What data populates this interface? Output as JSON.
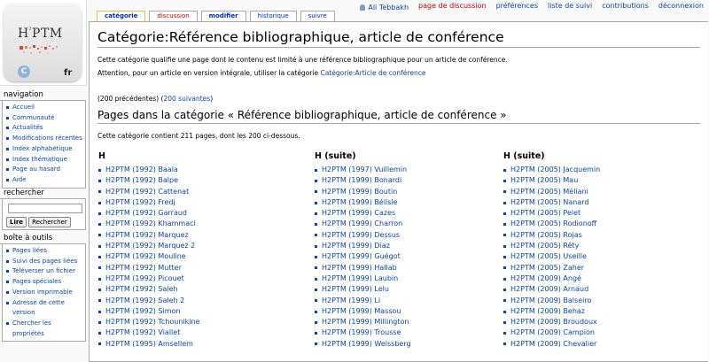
{
  "personal_tools": {
    "user": "Ali Tebbakh",
    "talk": "page de discussion",
    "preferences": "préférences",
    "watchlist": "liste de suivi",
    "contributions": "contributions",
    "logout": "déconnexion"
  },
  "logo": {
    "text": "H",
    "text_sup": "²",
    "text_rest": "PTM",
    "globe": "C",
    "lang": "fr"
  },
  "tabs": {
    "category": "catégorie",
    "discussion": "discussion",
    "edit": "modifier",
    "history": "historique",
    "watch": "suivre"
  },
  "navigation": {
    "title": "navigation",
    "items": [
      "Accueil",
      "Communauté",
      "Actualités",
      "Modifications récentes",
      "Index alphabétique",
      "Index thématique",
      "Page au hasard",
      "Aide"
    ]
  },
  "search": {
    "title": "rechercher",
    "go": "Lire",
    "search": "Rechercher"
  },
  "toolbox": {
    "title": "boîte à outils",
    "items": [
      "Pages liées",
      "Suivi des pages liées",
      "Téléverser un fichier",
      "Pages spéciales",
      "Version imprimable",
      "Adresse de cette version",
      "Chercher les propriétés"
    ]
  },
  "page": {
    "title": "Catégorie:Référence bibliographique, article de conférence",
    "intro": "Cette catégorie qualifie une page dont le contenu est limité à une référence bibliographique pour un article de conférence.",
    "attention_prefix": "Attention, pour un article en version intégrale, utiliser la catégorie ",
    "attention_link": "Catégorie:Article de conférence",
    "prev": "(200 précédentes) (",
    "next": "200 suivantes",
    "next_close": ")",
    "pages_heading": "Pages dans la catégorie « Référence bibliographique, article de conférence »",
    "count": "Cette catégorie contient 211 pages, dont les 200 ci-dessous."
  },
  "columns": [
    {
      "heading": "H",
      "items": [
        "H2PTM (1992) Baala",
        "H2PTM (1992) Balpe",
        "H2PTM (1992) Cattenat",
        "H2PTM (1992) Fredj",
        "H2PTM (1992) Garraud",
        "H2PTM (1992) Khammaci",
        "H2PTM (1992) Marquez",
        "H2PTM (1992) Marquez 2",
        "H2PTM (1992) Mouline",
        "H2PTM (1992) Mutter",
        "H2PTM (1992) Picouet",
        "H2PTM (1992) Saleh",
        "H2PTM (1992) Saleh 2",
        "H2PTM (1992) Simon",
        "H2PTM (1992) Tchounikine",
        "H2PTM (1992) Viallet",
        "H2PTM (1995) Amsellem"
      ]
    },
    {
      "heading": "H (suite)",
      "items": [
        "H2PTM (1997) Vuillemin",
        "H2PTM (1999) Bonardi",
        "H2PTM (1999) Boutin",
        "H2PTM (1999) Bélisle",
        "H2PTM (1999) Cazes",
        "H2PTM (1999) Charron",
        "H2PTM (1999) Dessus",
        "H2PTM (1999) Diaz",
        "H2PTM (1999) Guégot",
        "H2PTM (1999) Hallab",
        "H2PTM (1999) Laubin",
        "H2PTM (1999) Lelu",
        "H2PTM (1999) Li",
        "H2PTM (1999) Massou",
        "H2PTM (1999) Millington",
        "H2PTM (1999) Trousse",
        "H2PTM (1999) Weissberg"
      ]
    },
    {
      "heading": "H (suite)",
      "items": [
        "H2PTM (2005) Jacquemin",
        "H2PTM (2005) Mau",
        "H2PTM (2005) Méliani",
        "H2PTM (2005) Nanard",
        "H2PTM (2005) Pelet",
        "H2PTM (2005) Rodionoff",
        "H2PTM (2005) Rojas",
        "H2PTM (2005) Rêty",
        "H2PTM (2005) Useille",
        "H2PTM (2005) Zaher",
        "H2PTM (2009) Angé",
        "H2PTM (2009) Arnaud",
        "H2PTM (2009) Balseiro",
        "H2PTM (2009) Behaz",
        "H2PTM (2009) Broudoux",
        "H2PTM (2009) Campion",
        "H2PTM (2009) Chevalier"
      ]
    }
  ]
}
